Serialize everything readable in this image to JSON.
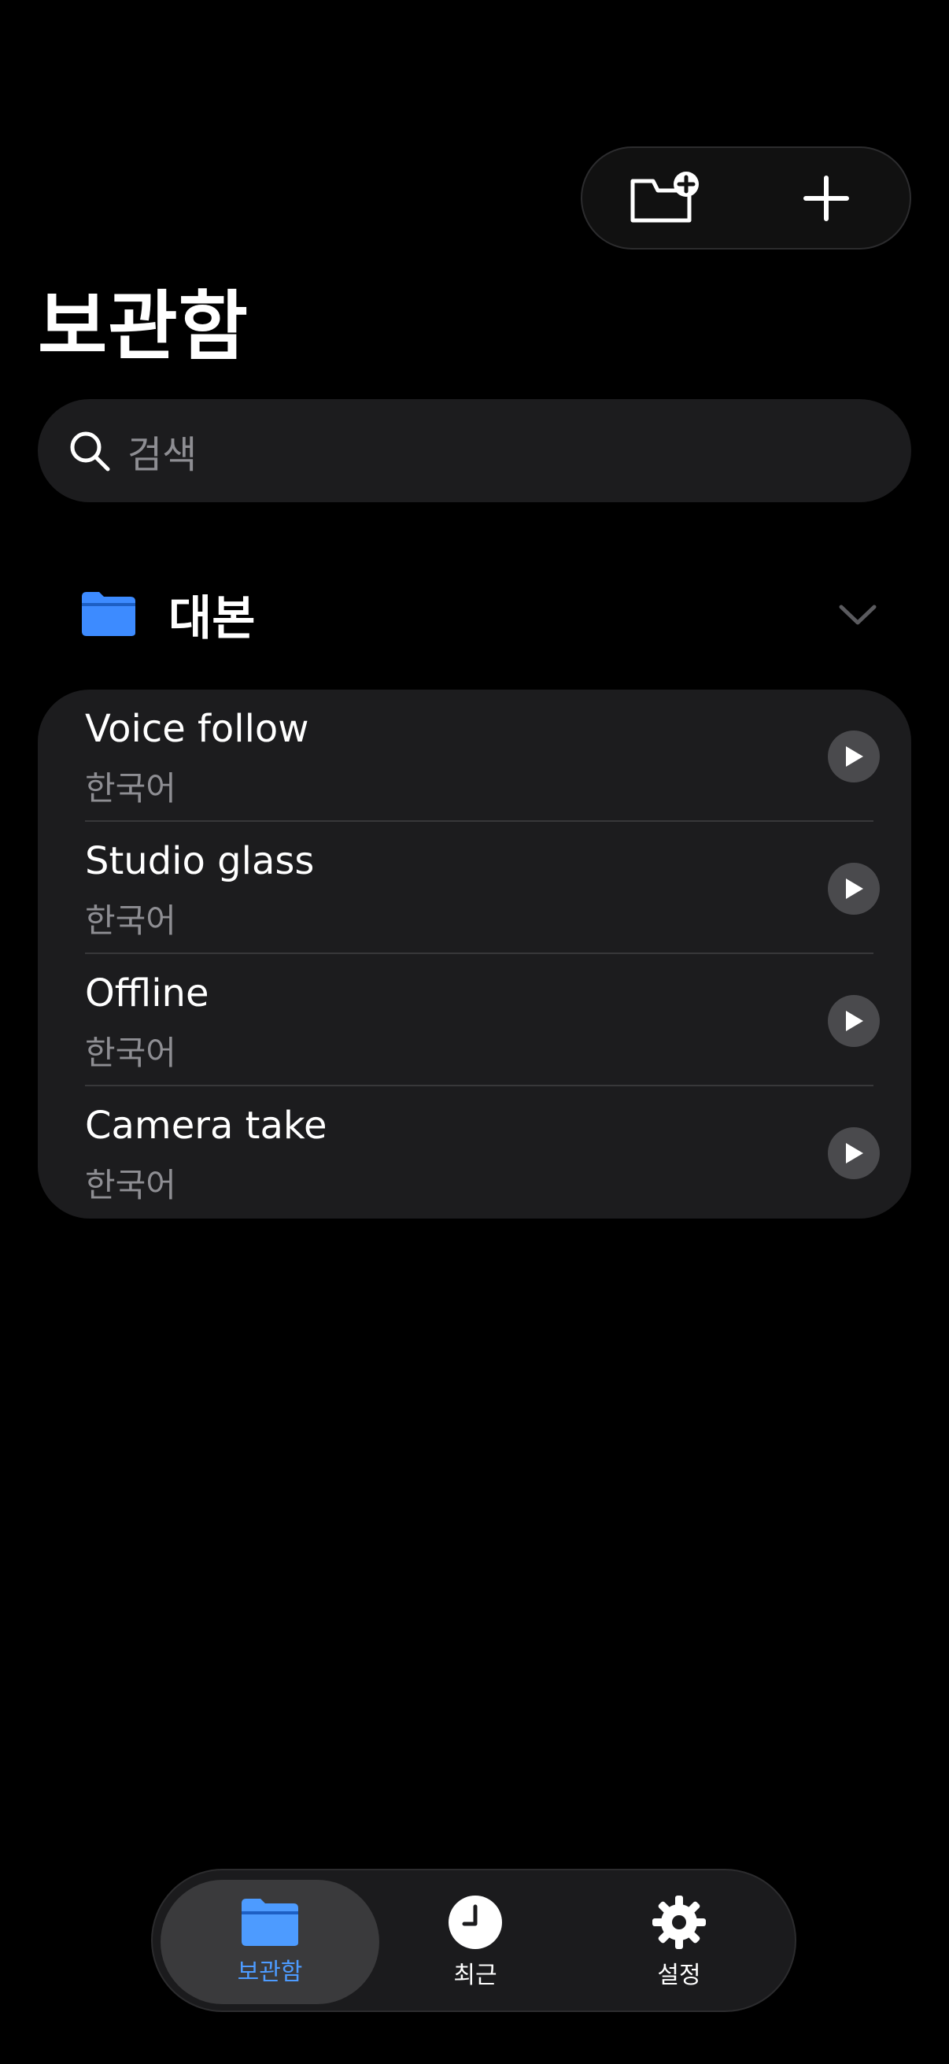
{
  "header": {
    "title": "보관함",
    "new_folder_icon": "folder-plus-icon",
    "add_icon": "plus-icon"
  },
  "search": {
    "placeholder": "검색",
    "icon": "search-icon"
  },
  "folder": {
    "name": "대본",
    "icon": "folder-icon",
    "color": "#3d8bff",
    "expanded": true
  },
  "scripts": [
    {
      "title": "Voice follow",
      "language": "한국어"
    },
    {
      "title": "Studio glass",
      "language": "한국어"
    },
    {
      "title": "Offline",
      "language": "한국어"
    },
    {
      "title": "Camera take",
      "language": "한국어"
    }
  ],
  "tabbar": {
    "tabs": [
      {
        "label": "보관함",
        "icon": "folder-icon",
        "active": true
      },
      {
        "label": "최근",
        "icon": "clock-icon",
        "active": false
      },
      {
        "label": "설정",
        "icon": "gear-icon",
        "active": false
      }
    ],
    "accent": "#4d9bff"
  }
}
